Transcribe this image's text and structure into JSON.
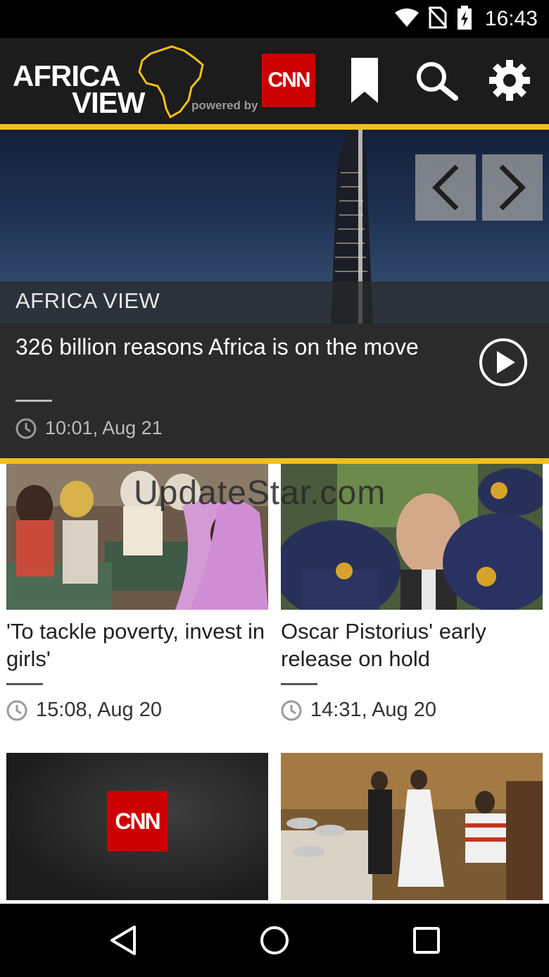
{
  "status_bar": {
    "time": "16:43"
  },
  "app_bar": {
    "logo_line1": "AFRICA",
    "logo_line2": "VIEW",
    "logo_powered": "powered by",
    "cnn_label": "CNN"
  },
  "hero": {
    "section": "AFRICA VIEW",
    "title": "326 billion reasons Africa is on the move",
    "time": "10:01, Aug 21"
  },
  "cards": [
    {
      "title": "'To tackle poverty, invest in girls'",
      "time": "15:08, Aug 20"
    },
    {
      "title": "Oscar Pistorius' early release on hold",
      "time": "14:31, Aug 20"
    },
    {
      "title": "",
      "time": "",
      "logo": "CNN"
    },
    {
      "title": "",
      "time": ""
    }
  ],
  "watermark": "UpdateStar.com",
  "colors": {
    "accent": "#f2c01b",
    "cnn_red": "#cc0000",
    "app_bar": "#1c1c1c"
  },
  "icons": [
    "wifi-icon",
    "no-sim-icon",
    "battery-charging-icon",
    "bookmark-icon",
    "search-icon",
    "settings-gear-icon",
    "chevron-left-icon",
    "chevron-right-icon",
    "play-circle-icon",
    "clock-icon",
    "back-nav-icon",
    "home-nav-icon",
    "recents-nav-icon"
  ]
}
